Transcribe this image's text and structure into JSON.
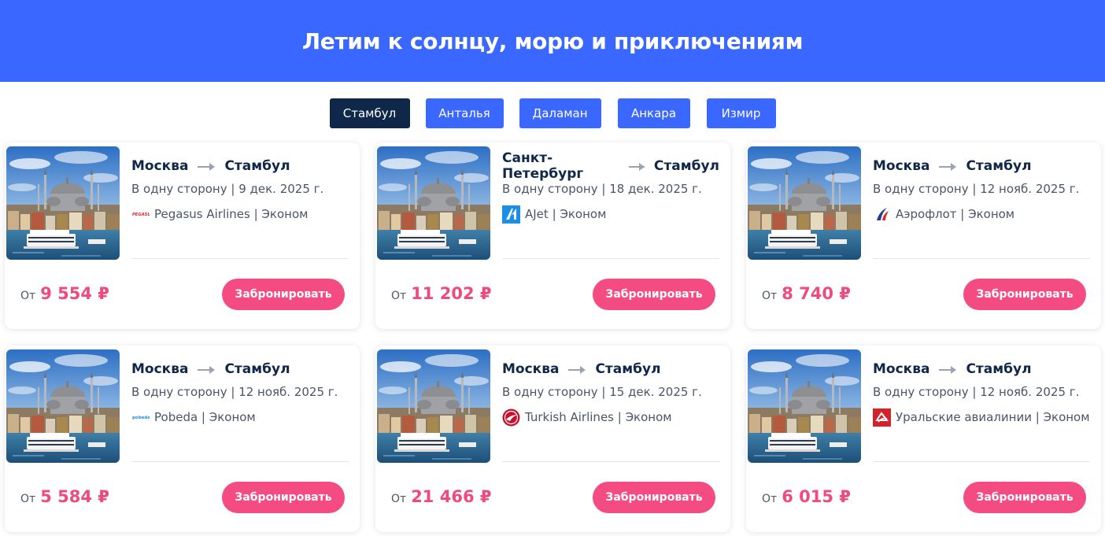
{
  "hero": {
    "title": "Летим к солнцу, морю и приключениям"
  },
  "tabs": [
    {
      "label": "Стамбул",
      "active": true
    },
    {
      "label": "Анталья",
      "active": false
    },
    {
      "label": "Даламан",
      "active": false
    },
    {
      "label": "Анкара",
      "active": false
    },
    {
      "label": "Измир",
      "active": false
    }
  ],
  "cards": [
    {
      "from": "Москва",
      "to": "Стамбул",
      "meta": "В одну сторону | 9 дек. 2025 г.",
      "airline": "Pegasus Airlines | Эконом",
      "logo": "pegasus-logo-icon",
      "price_prefix": "От",
      "price": "9 554 ₽",
      "button": "Забронировать"
    },
    {
      "from": "Санкт-Петербург",
      "to": "Стамбул",
      "meta": "В одну сторону | 18 дек. 2025 г.",
      "airline": "AJet | Эконом",
      "logo": "ajet-logo-icon",
      "price_prefix": "От",
      "price": "11 202 ₽",
      "button": "Забронировать"
    },
    {
      "from": "Москва",
      "to": "Стамбул",
      "meta": "В одну сторону | 12 нояб. 2025 г.",
      "airline": "Аэрофлот | Эконом",
      "logo": "aeroflot-logo-icon",
      "price_prefix": "От",
      "price": "8 740 ₽",
      "button": "Забронировать"
    },
    {
      "from": "Москва",
      "to": "Стамбул",
      "meta": "В одну сторону | 12 нояб. 2025 г.",
      "airline": "Pobeda | Эконом",
      "logo": "pobeda-logo-icon",
      "price_prefix": "От",
      "price": "5 584 ₽",
      "button": "Забронировать"
    },
    {
      "from": "Москва",
      "to": "Стамбул",
      "meta": "В одну сторону | 15 дек. 2025 г.",
      "airline": "Turkish Airlines | Эконом",
      "logo": "turkish-airlines-logo-icon",
      "price_prefix": "От",
      "price": "21 466 ₽",
      "button": "Забронировать"
    },
    {
      "from": "Москва",
      "to": "Стамбул",
      "meta": "В одну сторону | 12 нояб. 2025 г.",
      "airline": "Уральские авиалинии | Эконом",
      "logo": "ural-airlines-logo-icon",
      "price_prefix": "От",
      "price": "6 015 ₽",
      "button": "Забронировать"
    }
  ],
  "colors": {
    "accent": "#3a67ff",
    "active_tab": "#0f2749",
    "price": "#ef4a7e",
    "button": "#f34b82"
  }
}
